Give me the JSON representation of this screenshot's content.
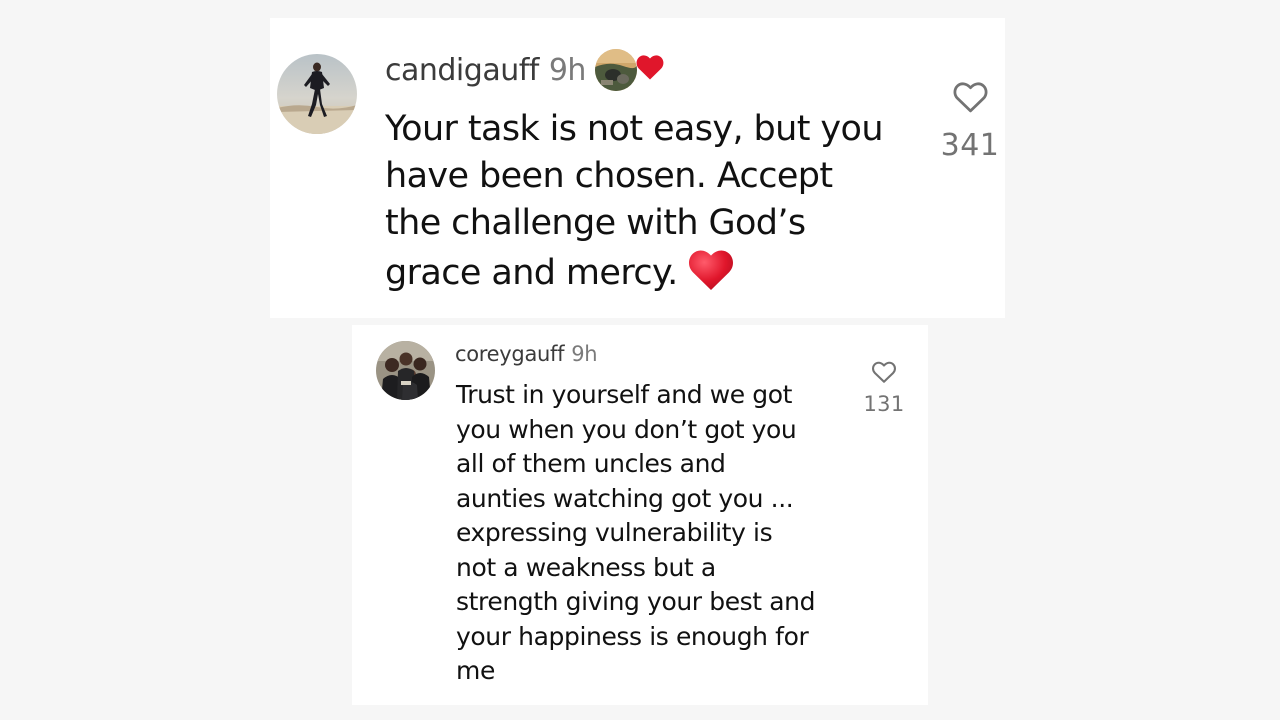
{
  "colors": {
    "background": "#f6f6f6",
    "card": "#ffffff",
    "text": "#111111",
    "muted": "#737373",
    "heart": "#e0162b"
  },
  "comment": {
    "username": "candigauff",
    "time": "9h",
    "text_lines": [
      "Your task is not easy, but you",
      "have been chosen.  Accept",
      "the challenge with God’s",
      "grace and mercy."
    ],
    "like_count": "341",
    "liked_by_author_icon": "red-heart-icon",
    "emoji": "red-heart-emoji"
  },
  "reply": {
    "username": "coreygauff",
    "time": "9h",
    "text_lines": [
      "Trust in yourself and we got",
      "you when you don’t got you",
      "all of them uncles and",
      "aunties watching got you ...",
      "expressing vulnerability is",
      "not a weakness but a",
      "strength giving your best and",
      "your happiness is enough for",
      "me"
    ],
    "like_count": "131"
  },
  "icons": {
    "like": "heart-outline-icon"
  }
}
